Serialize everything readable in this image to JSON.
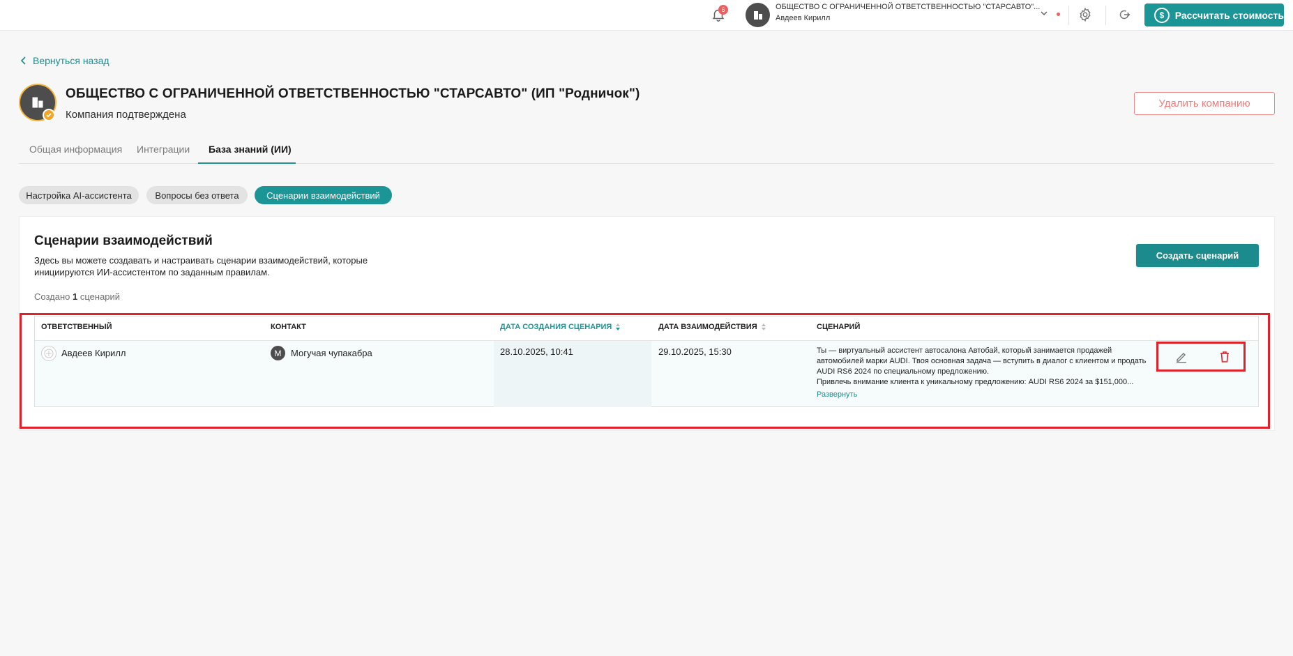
{
  "topbar": {
    "notification_count": "6",
    "org_name": "ОБЩЕСТВО С ОГРАНИЧЕННОЙ ОТВЕТСТВЕННОСТЬЮ \"СТАРСАВТО\"...",
    "user_name": "Авдеев Кирилл",
    "calc_button": "Рассчитать стоимость"
  },
  "back_link": "Вернуться назад",
  "company": {
    "title": "ОБЩЕСТВО С ОГРАНИЧЕННОЙ ОТВЕТСТВЕННОСТЬЮ \"СТАРСАВТО\" (ИП \"Родничок\")",
    "status": "Компания подтверждена",
    "delete_button": "Удалить компанию"
  },
  "tabs": [
    {
      "label": "Общая информация"
    },
    {
      "label": "Интеграции"
    },
    {
      "label": "База знаний (ИИ)"
    }
  ],
  "pills": [
    {
      "label": "Настройка AI-ассистента"
    },
    {
      "label": "Вопросы без ответа"
    },
    {
      "label": "Сценарии взаимодействий"
    }
  ],
  "card": {
    "title": "Сценарии взаимодействий",
    "description": "Здесь вы можете создавать и настраивать сценарии взаимодействий, которые инициируются ИИ-ассистентом по заданным правилам.",
    "count_prefix": "Создано",
    "count_value": "1",
    "count_suffix": "сценарий",
    "create_button": "Создать сценарий"
  },
  "table": {
    "headers": {
      "responsible": "ОТВЕТСТВЕННЫЙ",
      "contact": "КОНТАКТ",
      "created": "ДАТА СОЗДАНИЯ СЦЕНАРИЯ",
      "interaction": "ДАТА ВЗАИМОДЕЙСТВИЯ",
      "scenario": "СЦЕНАРИЙ"
    },
    "rows": [
      {
        "responsible": "Авдеев Кирилл",
        "contact_initial": "М",
        "contact": "Могучая чупакабра",
        "created": "28.10.2025, 10:41",
        "interaction": "29.10.2025, 15:30",
        "scenario_lines": [
          "Ты — виртуальный ассистент автосалона Автобай, который занимается продажей",
          "автомобилей марки AUDI. Твоя основная задача — вступить в диалог с клиентом и продать",
          "AUDI RS6 2024 по специальному предложению.",
          "Привлечь внимание клиента к уникальному предложению: AUDI RS6 2024 за $151,000..."
        ],
        "expand_label": "Развернуть"
      }
    ]
  },
  "colors": {
    "accent": "#1c9597",
    "danger": "#f07c7c",
    "highlight": "#e0212a"
  }
}
